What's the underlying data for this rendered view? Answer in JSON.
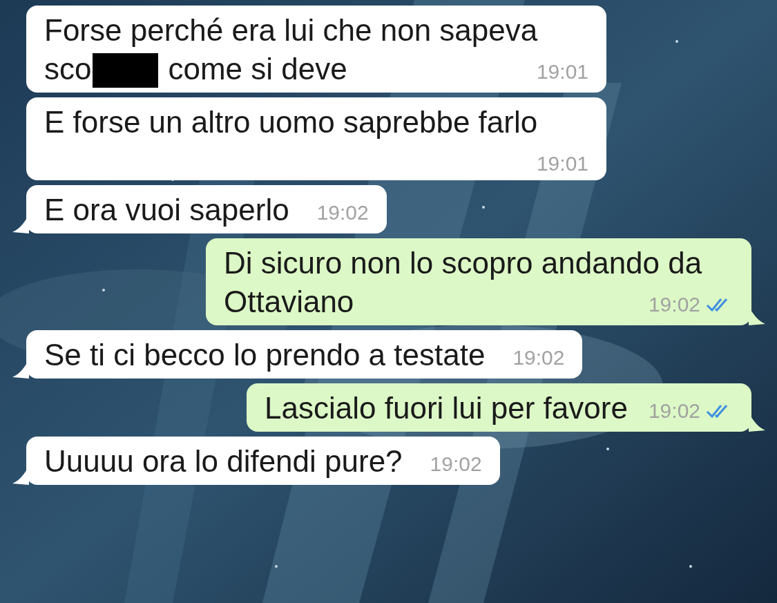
{
  "messages": [
    {
      "kind": "incoming",
      "tail": false,
      "segments": [
        {
          "kind": "text",
          "text": "Forse perché era lui che non sapeva sco"
        },
        {
          "kind": "redaction"
        },
        {
          "kind": "text",
          "text": "come si deve"
        }
      ],
      "time": "19:01"
    },
    {
      "kind": "incoming",
      "tail": false,
      "segments": [
        {
          "kind": "text",
          "text": "E forse un altro uomo saprebbe farlo"
        }
      ],
      "time": "19:01"
    },
    {
      "kind": "incoming",
      "tail": true,
      "segments": [
        {
          "kind": "text",
          "text": "E ora vuoi saperlo"
        }
      ],
      "time": "19:02"
    },
    {
      "kind": "outgoing",
      "tail": true,
      "read": true,
      "segments": [
        {
          "kind": "text",
          "text": "Di sicuro non lo scopro andando da Ottaviano"
        }
      ],
      "time": "19:02"
    },
    {
      "kind": "incoming",
      "tail": true,
      "segments": [
        {
          "kind": "text",
          "text": "Se ti ci becco lo prendo a testate"
        }
      ],
      "time": "19:02"
    },
    {
      "kind": "outgoing",
      "tail": true,
      "read": true,
      "segments": [
        {
          "kind": "text",
          "text": "Lascialo fuori lui per favore"
        }
      ],
      "time": "19:02"
    },
    {
      "kind": "incoming",
      "tail": true,
      "segments": [
        {
          "kind": "text",
          "text": "Uuuuu ora lo difendi pure?"
        }
      ],
      "time": "19:02"
    }
  ]
}
